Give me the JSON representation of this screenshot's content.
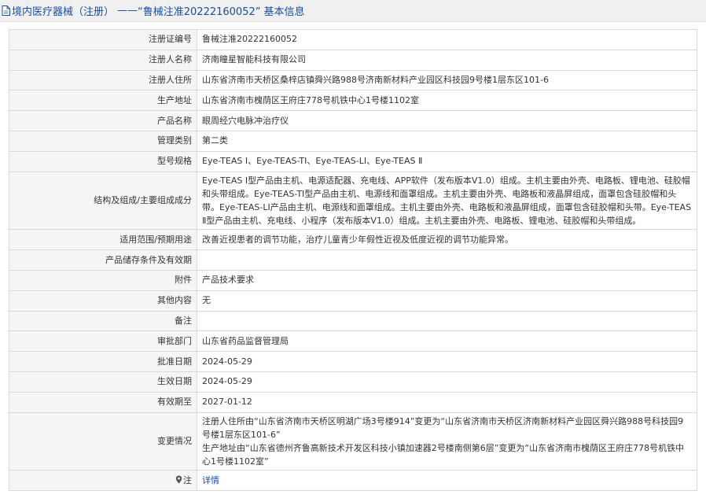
{
  "header": {
    "category_link": "境内医疗器械（注册）",
    "separator": "——",
    "reg_quoted": "“鲁械注准20222160052”",
    "suffix": "基本信息"
  },
  "rows": [
    {
      "label": "注册证编号",
      "value": "鲁械注准20222160052"
    },
    {
      "label": "注册人名称",
      "value": "济南瞳星智能科技有限公司"
    },
    {
      "label": "注册人住所",
      "value": "山东省济南市天桥区桑梓店镇舜兴路988号济南新材料产业园区科技园9号楼1层东区101-6"
    },
    {
      "label": "生产地址",
      "value": "山东省济南市槐荫区王府庄778号机铁中心1号楼1102室"
    },
    {
      "label": "产品名称",
      "value": "眼周经穴电脉冲治疗仪"
    },
    {
      "label": "管理类别",
      "value": "第二类"
    },
    {
      "label": "型号规格",
      "value": "Eye-TEAS Ⅰ、Eye-TEAS-TⅠ、Eye-TEAS-LⅠ、Eye-TEAS Ⅱ"
    },
    {
      "label": "结构及组成/主要组成成分",
      "value": "Eye-TEAS Ⅰ型产品由主机、电源适配器、充电线、APP软件（发布版本V1.0）组成。主机主要由外壳、电路板、锂电池、硅胶帽和头带组成。Eye-TEAS-TⅠ型产品由主机、电源线和面罩组成。主机主要由外壳、电路板和液晶屏组成，面罩包含硅胶帽和头带。Eye-TEAS-LⅠ产品由主机、电源线和面罩组成。主机主要由外壳、电路板和液晶屏组成，面罩包含硅胶帽和头带。Eye-TEAS Ⅱ型产品由主机、充电线、小程序（发布版本V1.0）组成。主机主要由外壳、电路板、锂电池、硅胶帽和头带组成。"
    },
    {
      "label": "适用范围/预期用途",
      "value": "改善近视患者的调节功能，治疗儿童青少年假性近视及低度近视的调节功能异常。"
    },
    {
      "label": "产品储存条件及有效期",
      "value": ""
    },
    {
      "label": "附件",
      "value": "产品技术要求"
    },
    {
      "label": "其他内容",
      "value": "无"
    },
    {
      "label": "备注",
      "value": ""
    },
    {
      "label": "审批部门",
      "value": "山东省药品监督管理局"
    },
    {
      "label": "批准日期",
      "value": "2024-05-29"
    },
    {
      "label": "生效日期",
      "value": "2024-05-29"
    },
    {
      "label": "有效期至",
      "value": "2027-01-12"
    }
  ],
  "change": {
    "label": "变更情况",
    "line1": "注册人住所由“山东省济南市天桥区明湖广场3号楼914”变更为“山东省济南市天桥区济南新材料产业园区舜兴路988号科技园9号楼1层东区101-6”",
    "line2": "生产地址由“山东省德州齐鲁高新技术开发区科技小镇加速器2号楼南侧第6层”变更为“山东省济南市槐荫区王府庄778号机铁中心1号楼1102室”"
  },
  "note": {
    "label": "注",
    "link": "详情"
  },
  "icons": {
    "header_icon": "document-icon",
    "note_icon": "pin-icon"
  },
  "colors": {
    "link": "#1a4fa0",
    "label_bg": "#f5f5f5",
    "border": "#d9d9d9",
    "header_bg": "#f0f0f0"
  }
}
